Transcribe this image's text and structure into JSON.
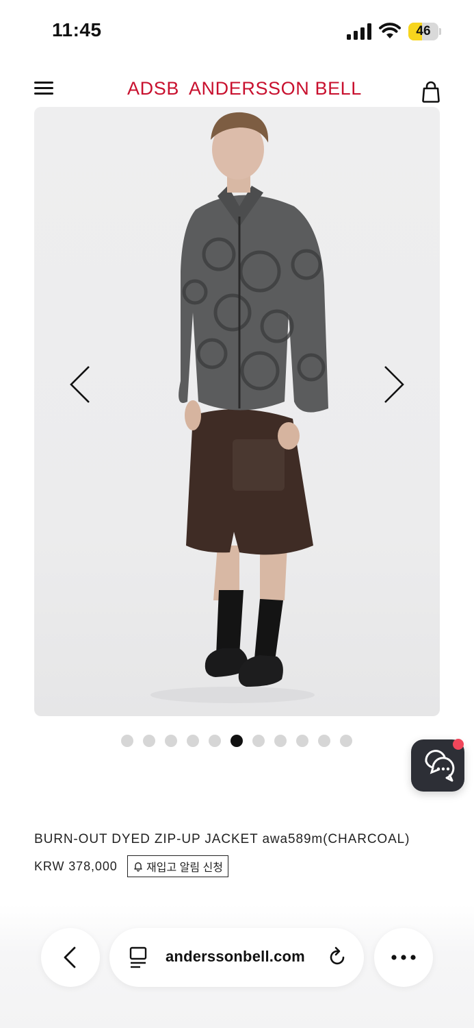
{
  "status_bar": {
    "time": "11:45",
    "battery": "46",
    "battery_level": 0.46
  },
  "header": {
    "brand_part1": "ADSB",
    "brand_part2": "ANDERSSON BELL"
  },
  "carousel": {
    "total": 11,
    "active_index": 5
  },
  "product": {
    "name": "BURN-OUT DYED ZIP-UP JACKET awa589m(CHARCOAL)",
    "price": "KRW 378,000",
    "restock_label": "재입고 알림 신청"
  },
  "browser": {
    "url": "anderssonbell.com"
  },
  "colors": {
    "brand": "#c8102e",
    "chat_bg": "#2d2f36",
    "badge": "#f0475b"
  },
  "icons": [
    "menu-icon",
    "shopping-bag-icon",
    "chevron-left-icon",
    "chevron-right-icon",
    "chat-icon",
    "bell-icon",
    "back-icon",
    "page-icon",
    "reload-icon",
    "more-icon",
    "signal-icon",
    "wifi-icon",
    "battery-icon"
  ]
}
